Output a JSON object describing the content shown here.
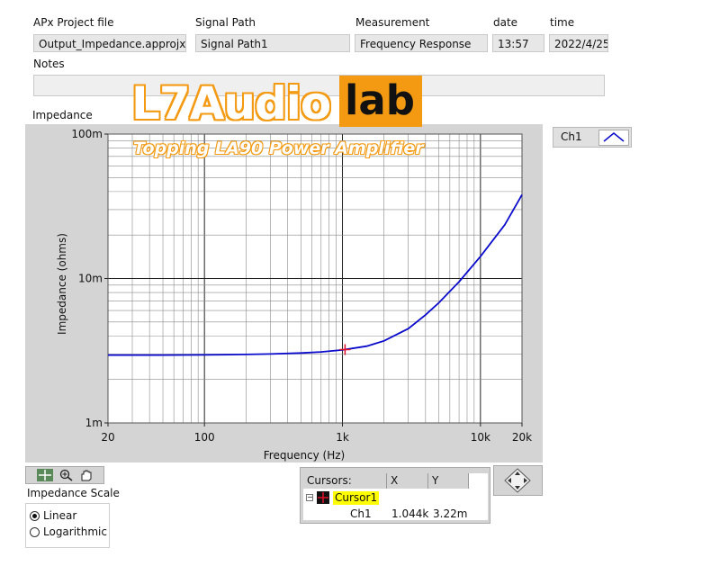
{
  "header": {
    "project_label": "APx Project file",
    "project_value": "Output_Impedance.approjx",
    "signal_label": "Signal Path",
    "signal_value": "Signal Path1",
    "measurement_label": "Measurement",
    "measurement_value": "Frequency Response",
    "date_label": "date",
    "date_value": "13:57",
    "time_label": "time",
    "time_value": "2022/4/25",
    "notes_label": "Notes",
    "notes_value": ""
  },
  "watermark": {
    "brand_part1": "L7Audio",
    "brand_part2": "lab",
    "subtitle": "Topping LA90 Power Amplifier",
    "color": "#f39a12"
  },
  "graph": {
    "title": "Impedance",
    "legend_name": "Ch1",
    "line_color": "#0a0acc",
    "cursor_color": "#e0102a",
    "tools": [
      "crosshair-tool-icon",
      "zoom-tool-icon",
      "pan-hand-icon"
    ]
  },
  "chart_data": {
    "type": "line",
    "title": "",
    "xlabel": "Frequency (Hz)",
    "ylabel": "Impedance (ohms)",
    "x_scale": "log",
    "y_scale": "log",
    "xlim": [
      20,
      20000
    ],
    "ylim": [
      0.001,
      0.1
    ],
    "grid": true,
    "x_ticks": [
      {
        "v": 20,
        "label": "20"
      },
      {
        "v": 100,
        "label": "100"
      },
      {
        "v": 1000,
        "label": "1k"
      },
      {
        "v": 10000,
        "label": "10k"
      },
      {
        "v": 20000,
        "label": "20k"
      }
    ],
    "y_ticks": [
      {
        "v": 0.001,
        "label": "1m"
      },
      {
        "v": 0.01,
        "label": "10m"
      },
      {
        "v": 0.1,
        "label": "100m"
      }
    ],
    "series": [
      {
        "name": "Ch1",
        "x": [
          20,
          50,
          100,
          200,
          300,
          500,
          700,
          1000,
          1500,
          2000,
          3000,
          4000,
          5000,
          7000,
          10000,
          15000,
          20000
        ],
        "y": [
          0.00295,
          0.00295,
          0.00296,
          0.00298,
          0.003,
          0.00305,
          0.0031,
          0.0032,
          0.0034,
          0.0037,
          0.0045,
          0.0056,
          0.0068,
          0.0095,
          0.0142,
          0.0235,
          0.038
        ]
      }
    ],
    "cursor": {
      "x": 1044,
      "y": 0.00322
    }
  },
  "scale_control": {
    "label": "Impedance Scale",
    "options": [
      "Linear",
      "Logarithmic"
    ],
    "selected": "Linear"
  },
  "cursors_panel": {
    "col_cursors": "Cursors:",
    "col_x": "X",
    "col_y": "Y",
    "cursor_name": "Cursor1",
    "channel": "Ch1",
    "x_value": "1.044k",
    "y_value": "3.22m"
  }
}
